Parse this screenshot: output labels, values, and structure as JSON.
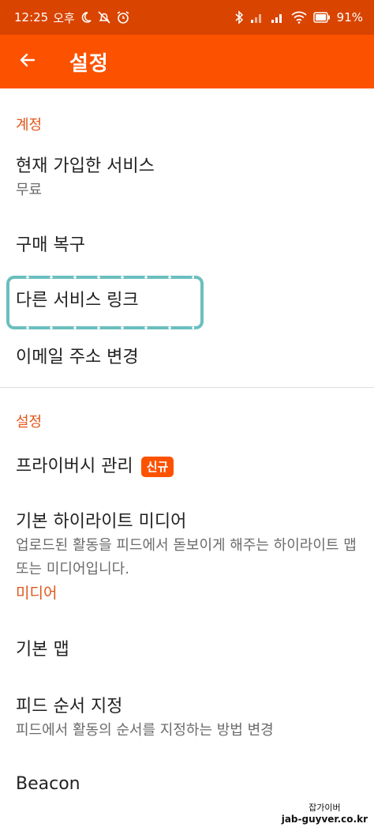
{
  "status_bar": {
    "time": "12:25",
    "ampm": "오후",
    "battery": "91%",
    "icons": [
      "moon-icon",
      "bell-off-icon",
      "alarm-icon",
      "bluetooth-icon",
      "signal-icon",
      "signal-icon",
      "wifi-icon",
      "battery-icon"
    ]
  },
  "app_bar": {
    "title": "설정",
    "back_icon": "arrow-left-icon"
  },
  "sections": {
    "account": {
      "header": "계정",
      "items": [
        {
          "title": "현재 가입한 서비스",
          "subtitle": "무료"
        },
        {
          "title": "구매 복구"
        },
        {
          "title": "다른 서비스 링크"
        },
        {
          "title": "이메일 주소 변경"
        }
      ]
    },
    "settings": {
      "header": "설정",
      "items": [
        {
          "title": "프라이버시 관리",
          "badge": "신규"
        },
        {
          "title": "기본 하이라이트 미디어",
          "subtitle": "업로드된 활동을 피드에서 돋보이게 해주는 하이라이트 맵 또는 미디어입니다.",
          "link": "미디어"
        },
        {
          "title": "기본 맵"
        },
        {
          "title": "피드 순서 지정",
          "subtitle": "피드에서 활동의 순서를 지정하는 방법 변경"
        },
        {
          "title": "Beacon"
        }
      ]
    }
  },
  "watermark": {
    "name": "잡가이버",
    "url": "jab-guyver.co.kr"
  },
  "colors": {
    "status_bar": "#d94400",
    "app_bar": "#fc5200",
    "accent_text": "#e0561b",
    "highlight_border": "#6bbfbf"
  }
}
